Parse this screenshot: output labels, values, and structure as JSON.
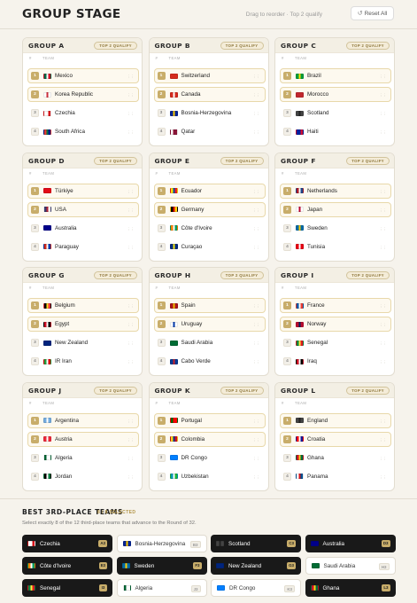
{
  "header": {
    "title": "GROUP STAGE",
    "hint": "Drag to reorder · Top 2 qualify",
    "reset_label": "Reset All"
  },
  "table_columns": {
    "pos": "#",
    "team": "TEAM"
  },
  "groups": [
    {
      "name": "GROUP A",
      "badge": "TOP 2 QUALIFY",
      "teams": [
        {
          "pos": "1",
          "name": "Mexico",
          "flag": "flag-mexico",
          "colors": [
            "#006847",
            "#ffffff",
            "#ce1126"
          ]
        },
        {
          "pos": "2",
          "name": "Korea Republic",
          "flag": "flag-korea-republic",
          "colors": [
            "#ffffff",
            "#cd2e3a",
            "#ffffff"
          ]
        },
        {
          "pos": "3",
          "name": "Czechia",
          "flag": "flag-czechia",
          "colors": [
            "#ffffff",
            "#ffffff",
            "#d7141a"
          ]
        },
        {
          "pos": "4",
          "name": "South Africa",
          "flag": "flag-south-africa",
          "colors": [
            "#e03c31",
            "#007749",
            "#001489"
          ]
        }
      ]
    },
    {
      "name": "GROUP B",
      "badge": "TOP 2 QUALIFY",
      "teams": [
        {
          "pos": "1",
          "name": "Switzerland",
          "flag": "flag-switzerland",
          "colors": [
            "#d52b1e",
            "#d52b1e",
            "#d52b1e"
          ]
        },
        {
          "pos": "2",
          "name": "Canada",
          "flag": "flag-canada",
          "colors": [
            "#d52b1e",
            "#ffffff",
            "#d52b1e"
          ]
        },
        {
          "pos": "3",
          "name": "Bosnia-Herzegovina",
          "flag": "flag-bosnia-herzegovina",
          "colors": [
            "#002395",
            "#fecb00",
            "#002395"
          ]
        },
        {
          "pos": "4",
          "name": "Qatar",
          "flag": "flag-qatar",
          "colors": [
            "#ffffff",
            "#8a1538",
            "#8a1538"
          ]
        }
      ]
    },
    {
      "name": "GROUP C",
      "badge": "TOP 2 QUALIFY",
      "teams": [
        {
          "pos": "1",
          "name": "Brazil",
          "flag": "flag-brazil",
          "colors": [
            "#009c3b",
            "#ffdf00",
            "#009c3b"
          ]
        },
        {
          "pos": "2",
          "name": "Morocco",
          "flag": "flag-morocco",
          "colors": [
            "#c1272d",
            "#c1272d",
            "#c1272d"
          ]
        },
        {
          "pos": "3",
          "name": "Scotland",
          "flag": "flag-scotland",
          "colors": [
            "#444444",
            "#222222",
            "#444444"
          ]
        },
        {
          "pos": "4",
          "name": "Haiti",
          "flag": "flag-haiti",
          "colors": [
            "#00209f",
            "#00209f",
            "#d21034"
          ]
        }
      ]
    },
    {
      "name": "GROUP D",
      "badge": "TOP 2 QUALIFY",
      "teams": [
        {
          "pos": "1",
          "name": "Türkiye",
          "flag": "flag-turkiye",
          "colors": [
            "#e30a17",
            "#e30a17",
            "#e30a17"
          ]
        },
        {
          "pos": "2",
          "name": "USA",
          "flag": "flag-usa",
          "colors": [
            "#3c3b6e",
            "#b22234",
            "#ffffff"
          ]
        },
        {
          "pos": "3",
          "name": "Australia",
          "flag": "flag-australia",
          "colors": [
            "#00008b",
            "#00008b",
            "#00008b"
          ]
        },
        {
          "pos": "4",
          "name": "Paraguay",
          "flag": "flag-paraguay",
          "colors": [
            "#d52b1e",
            "#ffffff",
            "#0038a8"
          ]
        }
      ]
    },
    {
      "name": "GROUP E",
      "badge": "TOP 2 QUALIFY",
      "teams": [
        {
          "pos": "1",
          "name": "Ecuador",
          "flag": "flag-ecuador",
          "colors": [
            "#ffdd00",
            "#034ea2",
            "#ed1c24"
          ]
        },
        {
          "pos": "2",
          "name": "Germany",
          "flag": "flag-germany",
          "colors": [
            "#000000",
            "#dd0000",
            "#ffce00"
          ]
        },
        {
          "pos": "3",
          "name": "Côte d'Ivoire",
          "flag": "flag-cote-divoire",
          "colors": [
            "#f77f00",
            "#ffffff",
            "#009e60"
          ]
        },
        {
          "pos": "4",
          "name": "Curaçao",
          "flag": "flag-curacao",
          "colors": [
            "#002b7f",
            "#f9e814",
            "#002b7f"
          ]
        }
      ]
    },
    {
      "name": "GROUP F",
      "badge": "TOP 2 QUALIFY",
      "teams": [
        {
          "pos": "1",
          "name": "Netherlands",
          "flag": "flag-netherlands",
          "colors": [
            "#ae1c28",
            "#ffffff",
            "#21468b"
          ]
        },
        {
          "pos": "2",
          "name": "Japan",
          "flag": "flag-japan",
          "colors": [
            "#ffffff",
            "#bc002d",
            "#ffffff"
          ]
        },
        {
          "pos": "3",
          "name": "Sweden",
          "flag": "flag-sweden",
          "colors": [
            "#006aa7",
            "#fecc00",
            "#006aa7"
          ]
        },
        {
          "pos": "4",
          "name": "Tunisia",
          "flag": "flag-tunisia",
          "colors": [
            "#e70013",
            "#ffffff",
            "#e70013"
          ]
        }
      ]
    },
    {
      "name": "GROUP G",
      "badge": "TOP 2 QUALIFY",
      "teams": [
        {
          "pos": "1",
          "name": "Belgium",
          "flag": "flag-belgium",
          "colors": [
            "#000000",
            "#fdda24",
            "#ef3340"
          ]
        },
        {
          "pos": "2",
          "name": "Egypt",
          "flag": "flag-egypt",
          "colors": [
            "#ce1126",
            "#ffffff",
            "#000000"
          ]
        },
        {
          "pos": "3",
          "name": "New Zealand",
          "flag": "flag-new-zealand",
          "colors": [
            "#00247d",
            "#00247d",
            "#00247d"
          ]
        },
        {
          "pos": "4",
          "name": "IR Iran",
          "flag": "flag-ir-iran",
          "colors": [
            "#239f40",
            "#ffffff",
            "#da0000"
          ]
        }
      ]
    },
    {
      "name": "GROUP H",
      "badge": "TOP 2 QUALIFY",
      "teams": [
        {
          "pos": "1",
          "name": "Spain",
          "flag": "flag-spain",
          "colors": [
            "#aa151b",
            "#f1bf00",
            "#aa151b"
          ]
        },
        {
          "pos": "2",
          "name": "Uruguay",
          "flag": "flag-uruguay",
          "colors": [
            "#ffffff",
            "#0038a8",
            "#ffffff"
          ]
        },
        {
          "pos": "3",
          "name": "Saudi Arabia",
          "flag": "flag-saudi-arabia",
          "colors": [
            "#006c35",
            "#006c35",
            "#006c35"
          ]
        },
        {
          "pos": "4",
          "name": "Cabo Verde",
          "flag": "flag-cabo-verde",
          "colors": [
            "#003893",
            "#cf2027",
            "#003893"
          ]
        }
      ]
    },
    {
      "name": "GROUP I",
      "badge": "TOP 2 QUALIFY",
      "teams": [
        {
          "pos": "1",
          "name": "France",
          "flag": "flag-france",
          "colors": [
            "#0055a4",
            "#ffffff",
            "#ef4135"
          ]
        },
        {
          "pos": "2",
          "name": "Norway",
          "flag": "flag-norway",
          "colors": [
            "#ba0c2f",
            "#00205b",
            "#ba0c2f"
          ]
        },
        {
          "pos": "3",
          "name": "Senegal",
          "flag": "flag-senegal",
          "colors": [
            "#00853f",
            "#fdef42",
            "#e31b23"
          ]
        },
        {
          "pos": "4",
          "name": "Iraq",
          "flag": "flag-iraq",
          "colors": [
            "#ce1126",
            "#ffffff",
            "#000000"
          ]
        }
      ]
    },
    {
      "name": "GROUP J",
      "badge": "TOP 2 QUALIFY",
      "teams": [
        {
          "pos": "1",
          "name": "Argentina",
          "flag": "flag-argentina",
          "colors": [
            "#74acdf",
            "#ffffff",
            "#74acdf"
          ]
        },
        {
          "pos": "2",
          "name": "Austria",
          "flag": "flag-austria",
          "colors": [
            "#ed2939",
            "#ffffff",
            "#ed2939"
          ]
        },
        {
          "pos": "3",
          "name": "Algeria",
          "flag": "flag-algeria",
          "colors": [
            "#006233",
            "#ffffff",
            "#ffffff"
          ]
        },
        {
          "pos": "4",
          "name": "Jordan",
          "flag": "flag-jordan",
          "colors": [
            "#000000",
            "#ffffff",
            "#007a3d"
          ]
        }
      ]
    },
    {
      "name": "GROUP K",
      "badge": "TOP 2 QUALIFY",
      "teams": [
        {
          "pos": "1",
          "name": "Portugal",
          "flag": "flag-portugal",
          "colors": [
            "#006600",
            "#ff0000",
            "#ff0000"
          ]
        },
        {
          "pos": "2",
          "name": "Colombia",
          "flag": "flag-colombia",
          "colors": [
            "#fcd116",
            "#003893",
            "#ce1126"
          ]
        },
        {
          "pos": "3",
          "name": "DR Congo",
          "flag": "flag-dr-congo",
          "colors": [
            "#007fff",
            "#007fff",
            "#007fff"
          ]
        },
        {
          "pos": "4",
          "name": "Uzbekistan",
          "flag": "flag-uzbekistan",
          "colors": [
            "#0099b5",
            "#ffffff",
            "#1eb53a"
          ]
        }
      ]
    },
    {
      "name": "GROUP L",
      "badge": "TOP 2 QUALIFY",
      "teams": [
        {
          "pos": "1",
          "name": "England",
          "flag": "flag-england",
          "colors": [
            "#444444",
            "#222222",
            "#444444"
          ]
        },
        {
          "pos": "2",
          "name": "Croatia",
          "flag": "flag-croatia",
          "colors": [
            "#ff0000",
            "#ffffff",
            "#171796"
          ]
        },
        {
          "pos": "3",
          "name": "Ghana",
          "flag": "flag-ghana",
          "colors": [
            "#ce1126",
            "#fcd116",
            "#006b3f"
          ]
        },
        {
          "pos": "4",
          "name": "Panama",
          "flag": "flag-panama",
          "colors": [
            "#ffffff",
            "#da121a",
            "#005293"
          ]
        }
      ]
    }
  ],
  "best_third": {
    "title": "BEST 3RD-PLACE TEAMS",
    "count": "8 / 8 SELECTED",
    "subtitle": "Select exactly 8 of the 12 third-place teams that advance to the Round of 32.",
    "teams": [
      {
        "name": "Czechia",
        "group": "A3",
        "selected": true,
        "colors": [
          "#ffffff",
          "#ffffff",
          "#d7141a"
        ]
      },
      {
        "name": "Bosnia-Herzegovina",
        "group": "B3",
        "selected": false,
        "colors": [
          "#002395",
          "#fecb00",
          "#002395"
        ]
      },
      {
        "name": "Scotland",
        "group": "C3",
        "selected": true,
        "colors": [
          "#444444",
          "#222222",
          "#444444"
        ]
      },
      {
        "name": "Australia",
        "group": "D3",
        "selected": true,
        "colors": [
          "#00008b",
          "#00008b",
          "#00008b"
        ]
      },
      {
        "name": "Côte d'Ivoire",
        "group": "E3",
        "selected": true,
        "colors": [
          "#f77f00",
          "#ffffff",
          "#009e60"
        ]
      },
      {
        "name": "Sweden",
        "group": "F3",
        "selected": true,
        "colors": [
          "#006aa7",
          "#fecc00",
          "#006aa7"
        ]
      },
      {
        "name": "New Zealand",
        "group": "G3",
        "selected": true,
        "colors": [
          "#00247d",
          "#00247d",
          "#00247d"
        ]
      },
      {
        "name": "Saudi Arabia",
        "group": "H3",
        "selected": false,
        "colors": [
          "#006c35",
          "#006c35",
          "#006c35"
        ]
      },
      {
        "name": "Senegal",
        "group": "I3",
        "selected": true,
        "colors": [
          "#00853f",
          "#fdef42",
          "#e31b23"
        ]
      },
      {
        "name": "Algeria",
        "group": "J3",
        "selected": false,
        "colors": [
          "#006233",
          "#ffffff",
          "#ffffff"
        ]
      },
      {
        "name": "DR Congo",
        "group": "K3",
        "selected": false,
        "colors": [
          "#007fff",
          "#007fff",
          "#007fff"
        ]
      },
      {
        "name": "Ghana",
        "group": "L3",
        "selected": true,
        "colors": [
          "#ce1126",
          "#fcd116",
          "#006b3f"
        ]
      }
    ]
  }
}
